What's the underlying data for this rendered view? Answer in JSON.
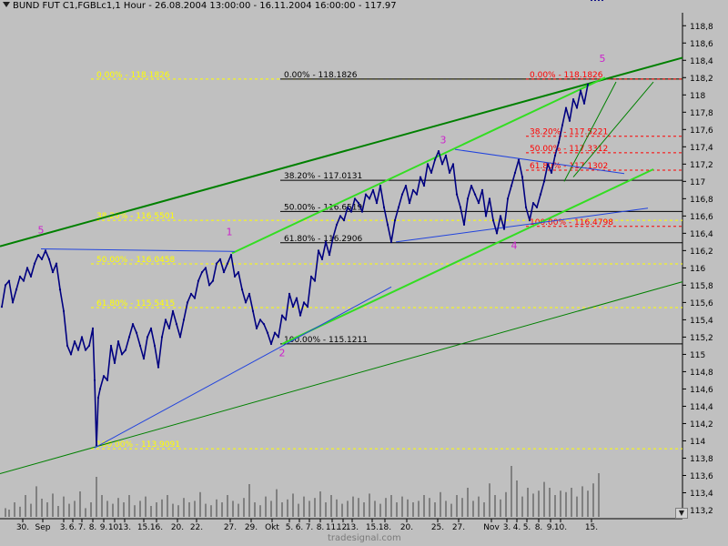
{
  "header": {
    "title": "BUND FUT C1,FGBLc1,1 Hour - 26.08.2004 13:00:00 - 16.11.2004 16:00:00 - 117.97"
  },
  "watermark": "tradesignal.com",
  "colors": {
    "background": "#c0c0c0",
    "price": "#000080",
    "volume": "#808080",
    "fib_black": "#000000",
    "fib_yellow": "#ffff00",
    "fib_red": "#ff0000",
    "channel_bright": "#33dd22",
    "channel_dark": "#008000",
    "trendline_blue": "#2244dd",
    "wave_label": "#cc22cc"
  },
  "chart_data": {
    "type": "line",
    "ylim": [
      113.1,
      118.95
    ],
    "y_ticks": [
      "113,2",
      "113,4",
      "113,6",
      "113,8",
      "114",
      "114,2",
      "114,4",
      "114,6",
      "114,8",
      "115",
      "115,2",
      "115,4",
      "115,6",
      "115,8",
      "116",
      "116,2",
      "116,4",
      "116,6",
      "116,8",
      "117",
      "117,2",
      "117,4",
      "117,6",
      "117,8",
      "118",
      "118,2",
      "118,4",
      "118,6",
      "118,8"
    ],
    "x_labels": [
      "30.",
      "Sep",
      "3.",
      "6.",
      "7.",
      "8.",
      "9.",
      "10.",
      "13.",
      "15.",
      "16.",
      "20.",
      "22.",
      "27.",
      "29.",
      "Okt",
      "5.",
      "6.",
      "7.",
      "8.",
      "11.",
      "12.",
      "13.",
      "15.",
      "18.",
      "20.",
      "25.",
      "27.",
      "Nov",
      "3.",
      "4.",
      "5.",
      "8.",
      "9.",
      "10.",
      "15."
    ],
    "x_label_pos": [
      25,
      47,
      70,
      80,
      90,
      102,
      114,
      126,
      137,
      158,
      172,
      195,
      216,
      253,
      276,
      299,
      318,
      329,
      340,
      352,
      365,
      377,
      387,
      409,
      423,
      447,
      481,
      504,
      540,
      557,
      568,
      579,
      592,
      605,
      616,
      650
    ],
    "price_series": {
      "name": "BUND FUT C1",
      "x": [
        2,
        6,
        10,
        14,
        18,
        22,
        26,
        30,
        34,
        38,
        42,
        46,
        50,
        54,
        58,
        62,
        66,
        70,
        74,
        78,
        82,
        86,
        90,
        94,
        98,
        102,
        104,
        106,
        108,
        110,
        114,
        118,
        122,
        126,
        130,
        134,
        138,
        142,
        146,
        150,
        154,
        158,
        162,
        166,
        170,
        174,
        178,
        182,
        186,
        190,
        194,
        198,
        202,
        206,
        210,
        214,
        218,
        222,
        226,
        230,
        234,
        238,
        242,
        246,
        250,
        254,
        258,
        262,
        266,
        270,
        274,
        278,
        282,
        286,
        290,
        294,
        298,
        302,
        306,
        310,
        314,
        318,
        322,
        326,
        330,
        334,
        338,
        342,
        346,
        350,
        354,
        358,
        362,
        366,
        370,
        374,
        378,
        382,
        386,
        390,
        394,
        398,
        402,
        406,
        410,
        414,
        418,
        422,
        426,
        430,
        434,
        438,
        442,
        446,
        450,
        454,
        458,
        462,
        466,
        470,
        474,
        478,
        482,
        486,
        490,
        494,
        498,
        502,
        506,
        510,
        514,
        518,
        522,
        526,
        530,
        534,
        538,
        542,
        546,
        550,
        554,
        558,
        562,
        566,
        570,
        574,
        578,
        582,
        586,
        590,
        594,
        598,
        602,
        606,
        610,
        614,
        618,
        622,
        626,
        630,
        634,
        638,
        642,
        646,
        650,
        654,
        658,
        662
      ],
      "values": [
        115.55,
        115.8,
        115.85,
        115.6,
        115.75,
        115.9,
        115.85,
        116.0,
        115.9,
        116.05,
        116.15,
        116.1,
        116.2,
        116.1,
        115.95,
        116.05,
        115.75,
        115.5,
        115.1,
        115.0,
        115.15,
        115.05,
        115.2,
        115.05,
        115.1,
        115.3,
        114.7,
        113.95,
        114.5,
        114.6,
        114.75,
        114.7,
        115.1,
        114.9,
        115.15,
        115.0,
        115.05,
        115.2,
        115.35,
        115.25,
        115.1,
        114.95,
        115.2,
        115.3,
        115.1,
        114.85,
        115.2,
        115.4,
        115.3,
        115.5,
        115.35,
        115.2,
        115.4,
        115.6,
        115.7,
        115.65,
        115.85,
        115.95,
        116.0,
        115.8,
        115.85,
        116.05,
        116.1,
        115.95,
        116.05,
        116.15,
        115.9,
        115.95,
        115.75,
        115.6,
        115.7,
        115.5,
        115.3,
        115.4,
        115.35,
        115.25,
        115.12,
        115.25,
        115.2,
        115.45,
        115.4,
        115.7,
        115.55,
        115.65,
        115.45,
        115.6,
        115.55,
        115.9,
        115.85,
        116.2,
        116.1,
        116.3,
        116.15,
        116.35,
        116.5,
        116.6,
        116.55,
        116.7,
        116.65,
        116.8,
        116.75,
        116.65,
        116.85,
        116.8,
        116.9,
        116.75,
        116.95,
        116.7,
        116.5,
        116.3,
        116.55,
        116.7,
        116.85,
        116.95,
        116.75,
        116.9,
        116.85,
        117.05,
        116.95,
        117.2,
        117.1,
        117.25,
        117.35,
        117.2,
        117.3,
        117.1,
        117.2,
        116.85,
        116.7,
        116.5,
        116.8,
        116.95,
        116.85,
        116.75,
        116.9,
        116.6,
        116.8,
        116.55,
        116.4,
        116.6,
        116.45,
        116.8,
        116.95,
        117.1,
        117.25,
        117.05,
        116.7,
        116.55,
        116.75,
        116.7,
        116.85,
        117.0,
        117.2,
        117.1,
        117.3,
        117.45,
        117.65,
        117.85,
        117.7,
        117.95,
        117.85,
        118.05,
        117.9,
        118.12
      ]
    },
    "volume_bars": {
      "x": [
        6,
        10,
        16,
        22,
        28,
        34,
        40,
        46,
        52,
        58,
        64,
        70,
        76,
        82,
        88,
        94,
        100,
        106,
        112,
        118,
        124,
        130,
        136,
        142,
        148,
        154,
        160,
        166,
        172,
        178,
        184,
        190,
        196,
        202,
        208,
        214,
        220,
        226,
        232,
        238,
        244,
        250,
        256,
        262,
        268,
        274,
        280,
        286,
        292,
        298,
        304,
        310,
        316,
        322,
        328,
        334,
        340,
        346,
        352,
        358,
        364,
        370,
        376,
        382,
        388,
        394,
        400,
        406,
        412,
        418,
        424,
        430,
        436,
        442,
        448,
        454,
        460,
        466,
        472,
        478,
        484,
        490,
        496,
        502,
        508,
        514,
        520,
        526,
        532,
        538,
        544,
        550,
        556,
        562,
        568,
        574,
        580,
        586,
        592,
        598,
        604,
        610,
        616,
        622,
        628,
        634,
        640,
        646,
        652,
        658
      ],
      "values": [
        0.12,
        0.1,
        0.2,
        0.14,
        0.3,
        0.18,
        0.42,
        0.25,
        0.2,
        0.32,
        0.15,
        0.28,
        0.18,
        0.22,
        0.35,
        0.12,
        0.2,
        0.55,
        0.3,
        0.22,
        0.18,
        0.26,
        0.2,
        0.3,
        0.16,
        0.22,
        0.28,
        0.15,
        0.2,
        0.24,
        0.3,
        0.18,
        0.16,
        0.26,
        0.2,
        0.22,
        0.34,
        0.18,
        0.16,
        0.24,
        0.2,
        0.3,
        0.22,
        0.18,
        0.26,
        0.45,
        0.2,
        0.16,
        0.28,
        0.22,
        0.38,
        0.2,
        0.24,
        0.32,
        0.18,
        0.28,
        0.22,
        0.26,
        0.35,
        0.2,
        0.3,
        0.24,
        0.18,
        0.22,
        0.28,
        0.26,
        0.2,
        0.32,
        0.22,
        0.18,
        0.26,
        0.3,
        0.2,
        0.28,
        0.24,
        0.2,
        0.22,
        0.3,
        0.26,
        0.2,
        0.34,
        0.22,
        0.18,
        0.3,
        0.26,
        0.4,
        0.22,
        0.28,
        0.2,
        0.46,
        0.3,
        0.24,
        0.34,
        0.7,
        0.5,
        0.28,
        0.4,
        0.32,
        0.36,
        0.48,
        0.4,
        0.3,
        0.36,
        0.34,
        0.4,
        0.28,
        0.42,
        0.36,
        0.46,
        0.6
      ]
    },
    "fib_black": [
      {
        "label": "0.00% - 118.1826",
        "value": 118.1826
      },
      {
        "label": "38.20% - 117.0131",
        "value": 117.0131
      },
      {
        "label": "50.00% - 116.6519",
        "value": 116.6519
      },
      {
        "label": "61.80% - 116.2906",
        "value": 116.2906
      },
      {
        "label": "100.00% - 115.1211",
        "value": 115.1211
      }
    ],
    "fib_yellow": [
      {
        "label": "0.00% - 118.1826",
        "value": 118.1826
      },
      {
        "label": "38.20% - 116.5501",
        "value": 116.5501
      },
      {
        "label": "50.00% - 116.0458",
        "value": 116.0458
      },
      {
        "label": "61.80% - 115.5415",
        "value": 115.5415
      },
      {
        "label": "100.00% - 113.9091",
        "value": 113.9091
      }
    ],
    "fib_red": [
      {
        "label": "0.00% - 118.1826",
        "value": 118.1826
      },
      {
        "label": "38.20% - 117.5221",
        "value": 117.5221
      },
      {
        "label": "50.00% - 117.3312",
        "value": 117.3312
      },
      {
        "label": "61.80% - 117.1302",
        "value": 117.1302
      },
      {
        "label": "100.00% - 116.4798",
        "value": 116.4798
      }
    ],
    "trendlines": [
      {
        "color": "dark",
        "width": 2,
        "p1": [
          0,
          116.25
        ],
        "p2": [
          750,
          118.43
        ]
      },
      {
        "color": "dark",
        "width": 1,
        "p1": [
          0,
          113.62
        ],
        "p2": [
          750,
          115.84
        ]
      },
      {
        "color": "bright",
        "width": 2,
        "p1": [
          255,
          116.17
        ],
        "p2": [
          665,
          118.2
        ]
      },
      {
        "color": "bright",
        "width": 2,
        "p1": [
          310,
          115.12
        ],
        "p2": [
          718,
          117.14
        ]
      },
      {
        "color": "dark",
        "width": 1,
        "p1": [
          630,
          117.05
        ],
        "p2": [
          718,
          118.15
        ]
      },
      {
        "color": "dark",
        "width": 1,
        "p1": [
          620,
          117.0
        ],
        "p2": [
          677,
          118.15
        ]
      },
      {
        "color": "blue",
        "width": 1,
        "p1": [
          104,
          113.92
        ],
        "p2": [
          430,
          115.78
        ]
      },
      {
        "color": "blue",
        "width": 1,
        "p1": [
          45,
          116.22
        ],
        "p2": [
          258,
          116.19
        ]
      },
      {
        "color": "blue",
        "width": 1,
        "p1": [
          500,
          117.37
        ],
        "p2": [
          686,
          117.09
        ]
      },
      {
        "color": "blue",
        "width": 1,
        "p1": [
          435,
          116.3
        ],
        "p2": [
          712,
          116.69
        ]
      }
    ],
    "wave_labels": [
      {
        "text": "5",
        "x": 45,
        "y": 116.4
      },
      {
        "text": "1",
        "x": 252,
        "y": 116.38
      },
      {
        "text": "2",
        "x": 310,
        "y": 114.98
      },
      {
        "text": "3",
        "x": 487,
        "y": 117.44
      },
      {
        "text": "4",
        "x": 565,
        "y": 116.22
      },
      {
        "text": "5",
        "x": 662,
        "y": 118.38
      }
    ]
  }
}
